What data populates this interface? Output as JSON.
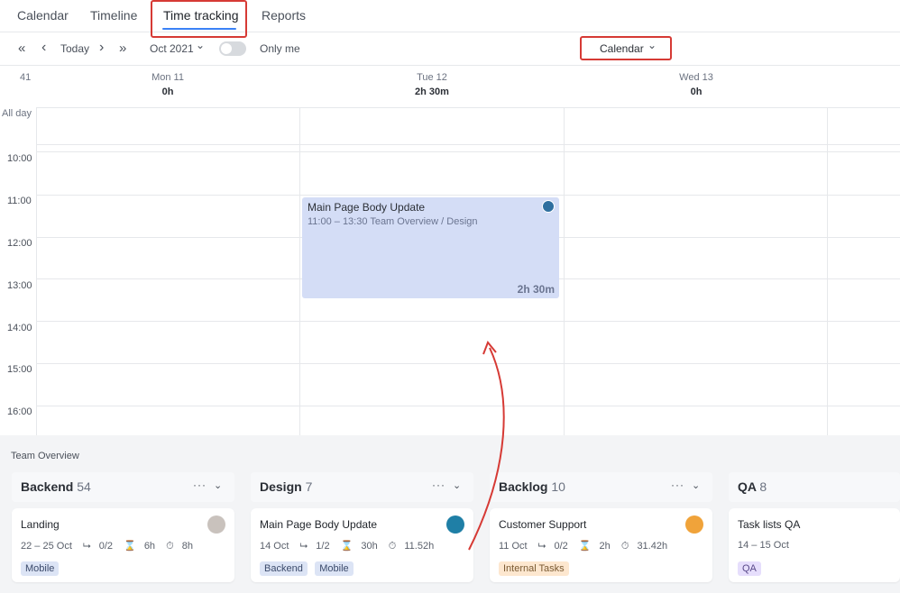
{
  "tabs": [
    "Calendar",
    "Timeline",
    "Time tracking",
    "Reports"
  ],
  "toolbar": {
    "first": "«",
    "prev": "‹",
    "today": "Today",
    "next": "›",
    "last": "»",
    "month": "Oct 2021",
    "month_chevron": "⌄",
    "only_me": "Only me",
    "view": "Calendar",
    "view_chevron": "⌄",
    "only_me_on": false
  },
  "calendar": {
    "week": "41",
    "days": [
      {
        "name": "Mon  11",
        "total": "0h"
      },
      {
        "name": "Tue  12",
        "total": "2h 30m"
      },
      {
        "name": "Wed  13",
        "total": "0h"
      }
    ],
    "allday_label": "All day",
    "hours": [
      "10:00",
      "11:00",
      "12:00",
      "13:00",
      "14:00",
      "15:00",
      "16:00"
    ],
    "event": {
      "title": "Main Page Body Update",
      "meta": "11:00 – 13:30  Team Overview  /  Design",
      "duration": "2h 30m"
    }
  },
  "board": {
    "title": "Team Overview",
    "more": "···",
    "chevron": "⌄",
    "columns": [
      {
        "name": "Backend",
        "count": "54"
      },
      {
        "name": "Design",
        "count": "7"
      },
      {
        "name": "Backlog",
        "count": "10"
      },
      {
        "name": "QA",
        "count": "8"
      }
    ],
    "cards": [
      {
        "title": "Landing",
        "dates": "22 – 25 Oct",
        "subtasks": "0/2",
        "estimate": "6h",
        "tracked": "8h",
        "tags": [
          "Mobile"
        ]
      },
      {
        "title": "Main Page Body Update",
        "dates": "14 Oct",
        "subtasks": "1/2",
        "estimate": "30h",
        "tracked": "11.52h",
        "tags": [
          "Backend",
          "Mobile"
        ]
      },
      {
        "title": "Customer Support",
        "dates": "11 Oct",
        "subtasks": "0/2",
        "estimate": "2h",
        "tracked": "31.42h",
        "tags": [
          "Internal Tasks"
        ]
      },
      {
        "title": "Task lists QA",
        "dates": "14 – 15 Oct",
        "tags": [
          "QA"
        ]
      }
    ]
  },
  "colors": {
    "accent": "#3b82f6",
    "highlight": "#d63a35",
    "event": "#d4ddf6"
  }
}
